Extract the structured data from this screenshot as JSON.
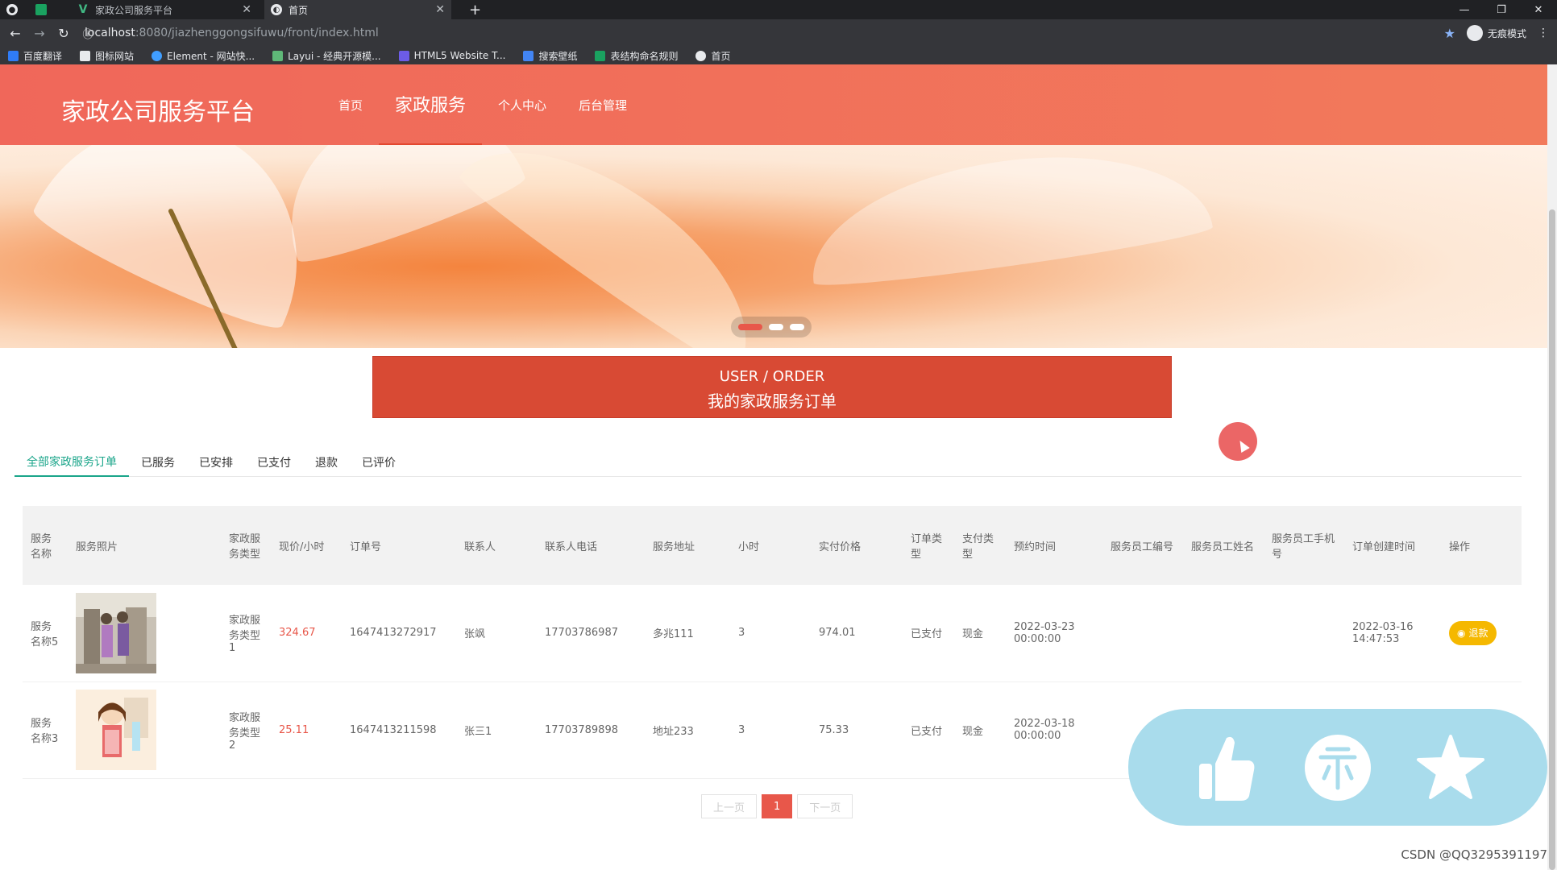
{
  "browser": {
    "tabs": [
      {
        "title": "家政公司服务平台",
        "active": false
      },
      {
        "title": "首页",
        "active": true
      }
    ],
    "new_tab": "+",
    "url_host": "localhost",
    "url_path": ":8080/jiazhenggongsifuwu/front/index.html",
    "incognito_label": "无痕模式",
    "bookmarks": [
      "百度翻译",
      "图标网站",
      "Element - 网站快...",
      "Layui - 经典开源模...",
      "HTML5 Website T...",
      "搜索壁纸",
      "表结构命名规则",
      "首页"
    ]
  },
  "site": {
    "title": "家政公司服务平台",
    "nav": [
      {
        "label": "首页",
        "active": false
      },
      {
        "label": "家政服务",
        "active": true
      },
      {
        "label": "个人中心",
        "active": false
      },
      {
        "label": "后台管理",
        "active": false
      }
    ]
  },
  "section": {
    "title_en": "USER / ORDER",
    "title_cn": "我的家政服务订单"
  },
  "order_tabs": [
    {
      "label": "全部家政服务订单",
      "active": true
    },
    {
      "label": "已服务",
      "active": false
    },
    {
      "label": "已安排",
      "active": false
    },
    {
      "label": "已支付",
      "active": false
    },
    {
      "label": "退款",
      "active": false
    },
    {
      "label": "已评价",
      "active": false
    }
  ],
  "table": {
    "headers": [
      "服务名称",
      "服务照片",
      "家政服务类型",
      "现价/小时",
      "订单号",
      "联系人",
      "联系人电话",
      "服务地址",
      "小时",
      "实付价格",
      "订单类型",
      "支付类型",
      "预约时间",
      "服务员工编号",
      "服务员工姓名",
      "服务员工手机号",
      "订单创建时间",
      "操作"
    ],
    "rows": [
      {
        "name": "服务名称5",
        "photo": "service-photo-1",
        "type": "家政服务类型1",
        "price": "324.67",
        "order_no": "1647413272917",
        "contact": "张飒",
        "phone": "17703786987",
        "address": "多兆111",
        "hours": "3",
        "paid": "974.01",
        "order_type": "已支付",
        "pay_type": "现金",
        "appointment": "2022-03-23 00:00:00",
        "staff_no": "",
        "staff_name": "",
        "staff_phone": "",
        "created": "2022-03-16 14:47:53",
        "action": "退款"
      },
      {
        "name": "服务名称3",
        "photo": "service-photo-2",
        "type": "家政服务类型2",
        "price": "25.11",
        "order_no": "1647413211598",
        "contact": "张三1",
        "phone": "17703789898",
        "address": "地址233",
        "hours": "3",
        "paid": "75.33",
        "order_type": "已支付",
        "pay_type": "现金",
        "appointment": "2022-03-18 00:00:00",
        "staff_no": "",
        "staff_name": "",
        "staff_phone": "",
        "created": "",
        "action": ""
      }
    ]
  },
  "pager": {
    "prev": "上一页",
    "current": "1",
    "next": "下一页"
  },
  "colors": {
    "header": "#f0675a",
    "accent": "#d84a34",
    "tab_active": "#1aa58a",
    "price": "#e8574a",
    "refund": "#f5b800",
    "float_panel": "#a9dcec"
  },
  "float_icons": [
    "thumbs-up-icon",
    "coin-icon",
    "star-icon"
  ],
  "watermark": "CSDN @QQ3295391197"
}
